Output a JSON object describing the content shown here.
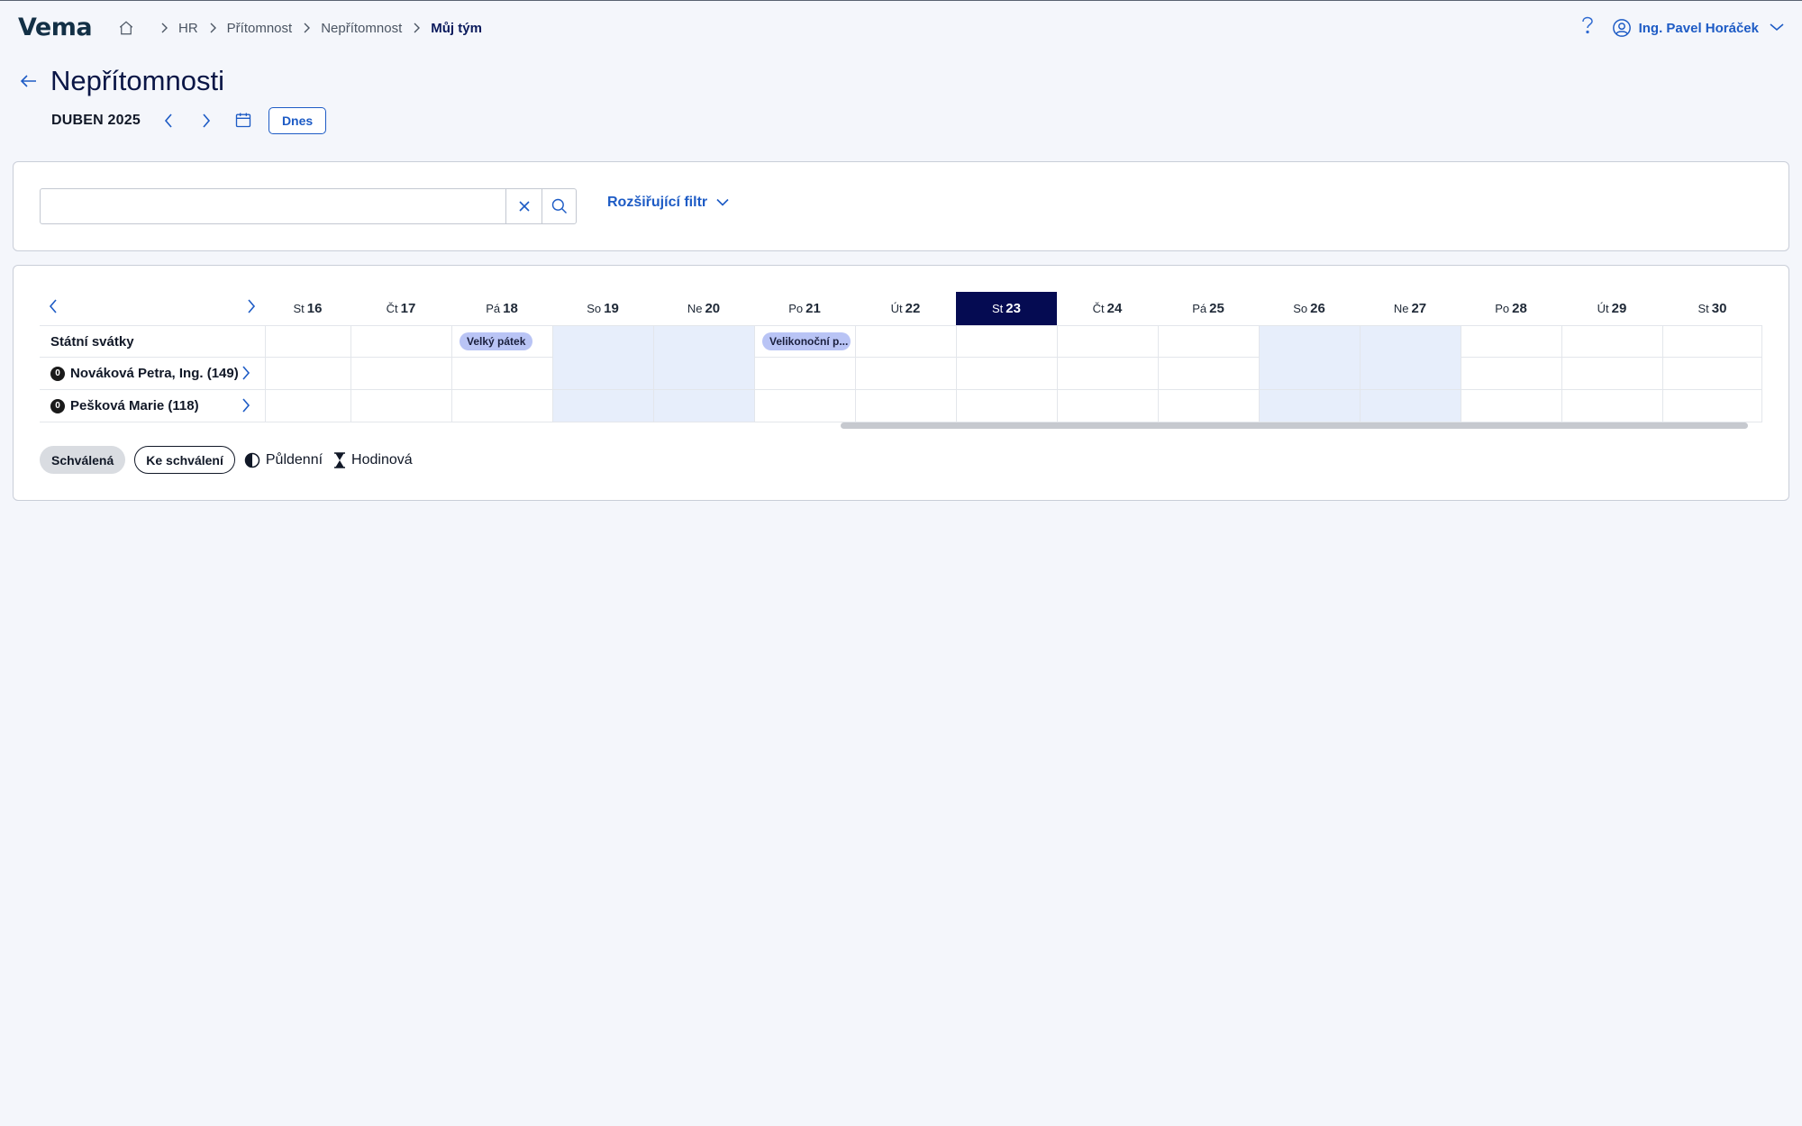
{
  "app": {
    "logo": "Vema"
  },
  "breadcrumb": {
    "items": [
      "HR",
      "Přítomnost",
      "Nepřítomnost"
    ],
    "current": "Můj tým"
  },
  "user": {
    "name": "Ing. Pavel Horáček"
  },
  "page": {
    "title": "Nepřítomnosti"
  },
  "calendar_nav": {
    "month": "DUBEN 2025",
    "today_label": "Dnes"
  },
  "filter": {
    "search_value": "",
    "extended_label": "Rozšiřující filtr"
  },
  "days": [
    {
      "name": "St",
      "num": "16",
      "weekend": false,
      "today": false
    },
    {
      "name": "Čt",
      "num": "17",
      "weekend": false,
      "today": false
    },
    {
      "name": "Pá",
      "num": "18",
      "weekend": false,
      "today": false
    },
    {
      "name": "So",
      "num": "19",
      "weekend": true,
      "today": false
    },
    {
      "name": "Ne",
      "num": "20",
      "weekend": true,
      "today": false
    },
    {
      "name": "Po",
      "num": "21",
      "weekend": false,
      "today": false
    },
    {
      "name": "Út",
      "num": "22",
      "weekend": false,
      "today": false
    },
    {
      "name": "St",
      "num": "23",
      "weekend": false,
      "today": true
    },
    {
      "name": "Čt",
      "num": "24",
      "weekend": false,
      "today": false
    },
    {
      "name": "Pá",
      "num": "25",
      "weekend": false,
      "today": false
    },
    {
      "name": "So",
      "num": "26",
      "weekend": true,
      "today": false
    },
    {
      "name": "Ne",
      "num": "27",
      "weekend": true,
      "today": false
    },
    {
      "name": "Po",
      "num": "28",
      "weekend": false,
      "today": false
    },
    {
      "name": "Út",
      "num": "29",
      "weekend": false,
      "today": false
    },
    {
      "name": "St",
      "num": "30",
      "weekend": false,
      "today": false
    }
  ],
  "rows": [
    {
      "label": "Státní svátky",
      "badge": "",
      "expandable": false,
      "events": [
        {
          "day_index": 2,
          "label": "Velký pátek"
        },
        {
          "day_index": 5,
          "label": "Velikonoční p..."
        }
      ]
    },
    {
      "label": "Nováková Petra, Ing. (149)",
      "badge": "0",
      "expandable": true,
      "events": []
    },
    {
      "label": "Pešková Marie (118)",
      "badge": "0",
      "expandable": true,
      "events": []
    }
  ],
  "legend": {
    "approved": "Schválená",
    "pending": "Ke schválení",
    "half_day": "Půldenní",
    "hourly": "Hodinová"
  },
  "colors": {
    "accent": "#1d5bc5",
    "today_bg": "#050b52",
    "weekend_bg": "#e7eefb",
    "holiday_pill": "#b9c4f5"
  }
}
